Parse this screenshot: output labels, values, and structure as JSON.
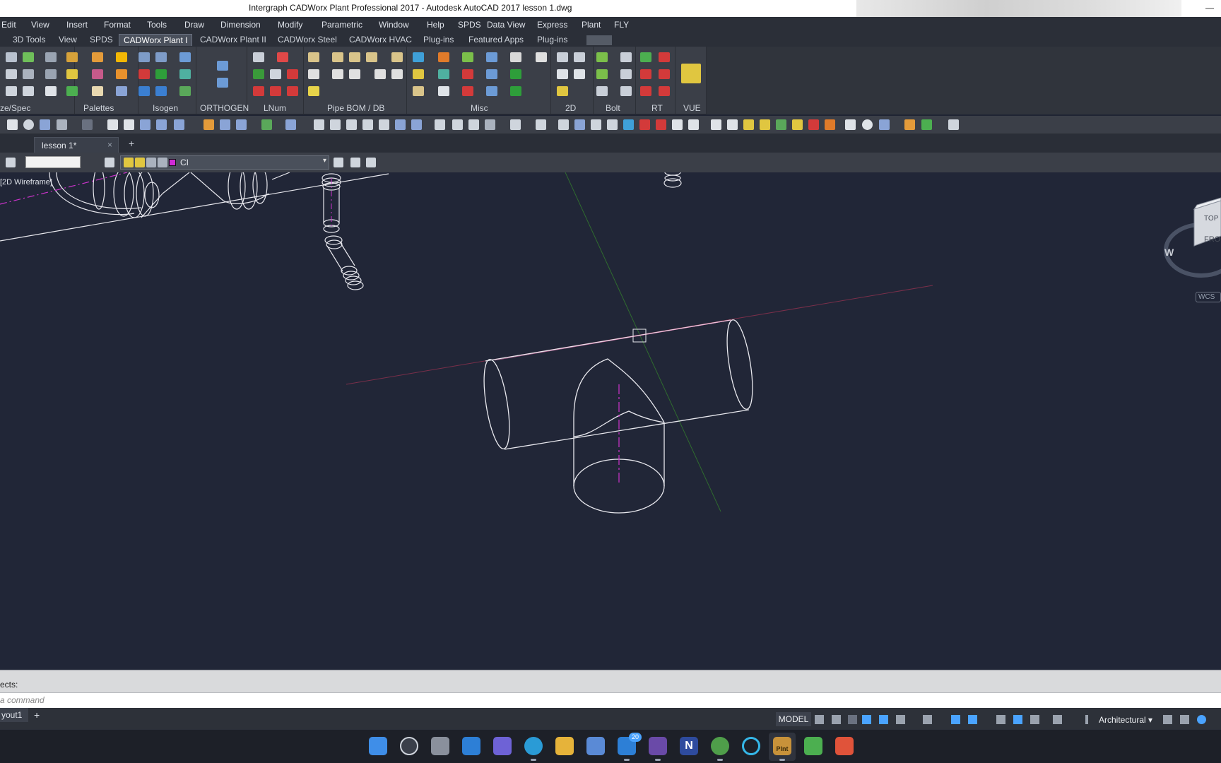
{
  "window": {
    "title": "Intergraph CADWorx Plant Professional 2017 - Autodesk AutoCAD 2017   lesson 1.dwg",
    "minimize_glyph": "—"
  },
  "menu": [
    "Edit",
    "View",
    "Insert",
    "Format",
    "Tools",
    "Draw",
    "Dimension",
    "Modify",
    "Parametric",
    "Window",
    "Help",
    "SPDS",
    "Data View",
    "Express",
    "Plant",
    "FLY"
  ],
  "ribbon_tabs": [
    {
      "label": "3D Tools"
    },
    {
      "label": "View"
    },
    {
      "label": "SPDS"
    },
    {
      "label": "CADWorx Plant I",
      "active": true
    },
    {
      "label": "CADWorx Plant II"
    },
    {
      "label": "CADWorx Steel"
    },
    {
      "label": "CADWorx HVAC"
    },
    {
      "label": "Plug-ins"
    },
    {
      "label": "Featured Apps"
    },
    {
      "label": "Plug-ins"
    }
  ],
  "ribbon_groups": [
    "ze/Spec",
    "Palettes",
    "Isogen",
    "ORTHOGEN",
    "LNum",
    "Pipe BOM / DB",
    "Misc",
    "2D",
    "Bolt",
    "RT",
    "VUE"
  ],
  "document": {
    "tab_label": "lesson 1*",
    "close_glyph": "×",
    "new_tab_glyph": "+"
  },
  "layer": {
    "current_name": "CI",
    "swatch_color": "#d02bd6",
    "arrow_glyph": "▾"
  },
  "viewport": {
    "label": "[2D Wireframe]",
    "viewcube_faces": [
      "TOP",
      "FRO"
    ],
    "compass_letter": "W",
    "wcs_label": "WCS"
  },
  "command": {
    "history_text": "ects:",
    "prompt_placeholder": "a command"
  },
  "status": {
    "layout_tab": "yout1",
    "layout_plus": "+",
    "model_label": "MODEL",
    "units": "Architectural",
    "units_arrow": "▾"
  },
  "taskbar": {
    "mail_badge": "20",
    "active_app_label": "Plnt",
    "onenote_letter": "N"
  },
  "colors": {
    "canvas_bg": "#212637",
    "geometry": "#e8e8ee",
    "centerline": "#cc33cc",
    "y_axis": "#2f6b2f",
    "x_axis": "#7a2f4a",
    "accent": "#4aa3ff"
  }
}
